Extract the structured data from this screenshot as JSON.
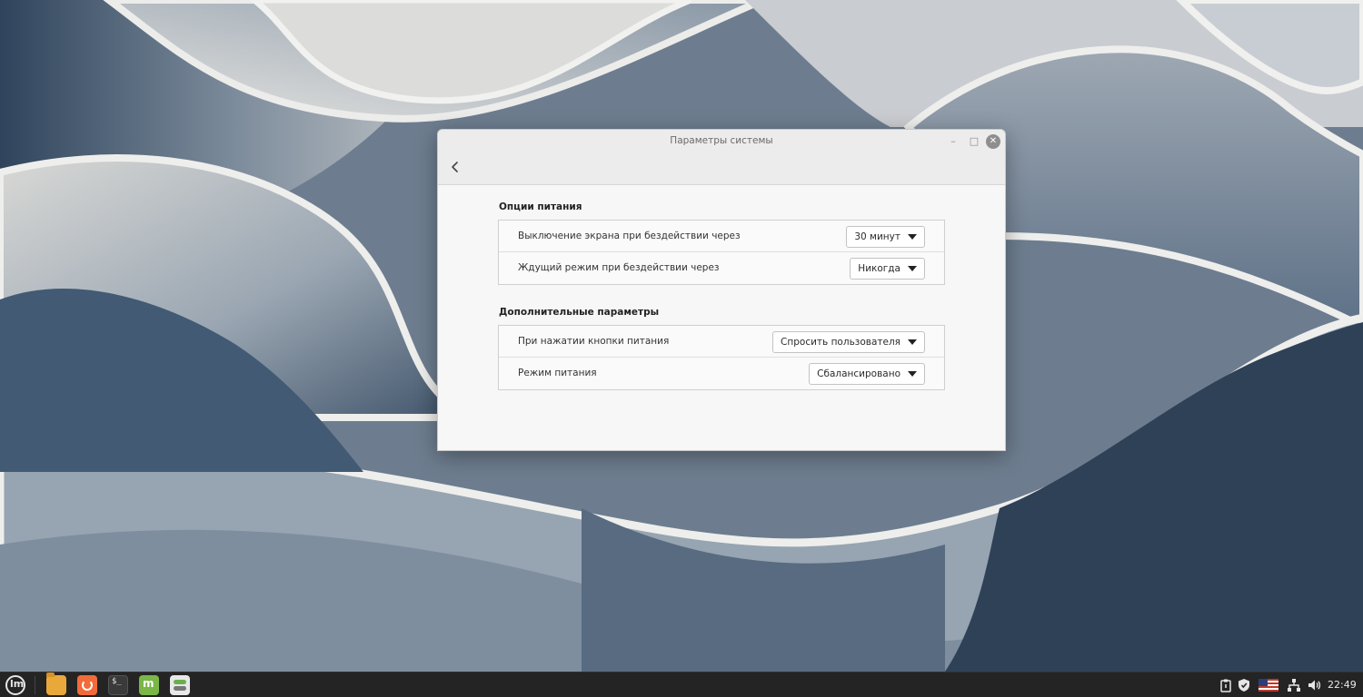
{
  "window": {
    "title": "Параметры системы"
  },
  "sections": [
    {
      "title": "Опции питания",
      "rows": [
        {
          "label": "Выключение экрана при бездействии через",
          "value": "30 минут"
        },
        {
          "label": "Ждущий режим при бездействии через",
          "value": "Никогда"
        }
      ]
    },
    {
      "title": "Дополнительные параметры",
      "rows": [
        {
          "label": "При нажатии кнопки питания",
          "value": "Спросить пользователя"
        },
        {
          "label": "Режим питания",
          "value": "Сбалансировано"
        }
      ]
    }
  ],
  "taskbar": {
    "apps": [
      "menu-icon",
      "files-icon",
      "update-manager-icon",
      "terminal-icon",
      "mint-welcome-icon",
      "system-settings-icon"
    ],
    "tray": [
      "clipboard-icon",
      "shield-icon",
      "us-flag-icon",
      "network-icon",
      "volume-icon"
    ],
    "clock": "22:49"
  },
  "colors": {
    "taskbar": "#242424",
    "window_bg": "#f7f7f7",
    "titlebar_bg": "#ececec"
  }
}
